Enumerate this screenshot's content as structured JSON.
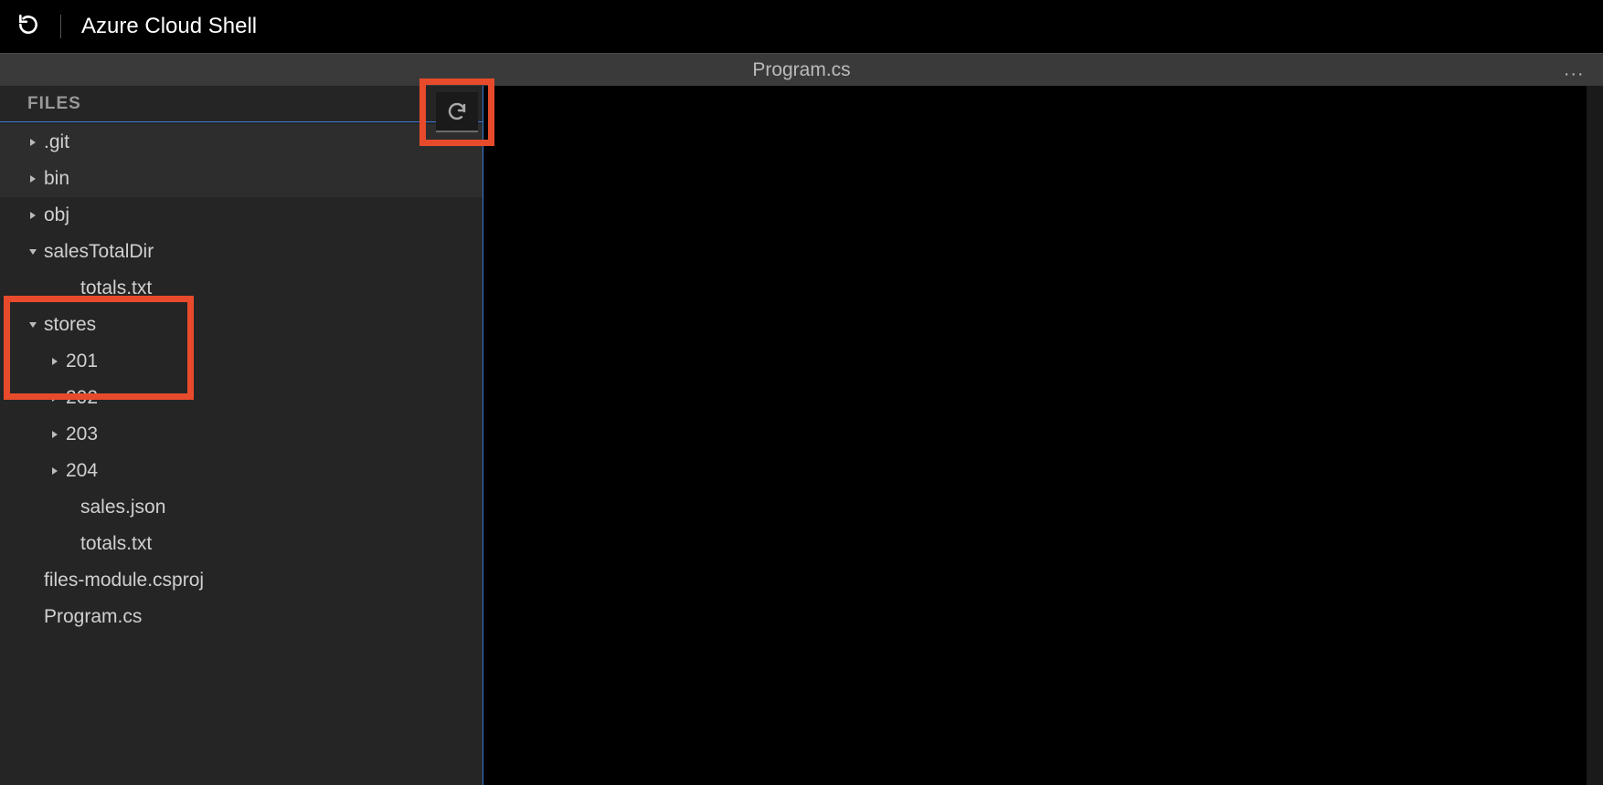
{
  "header": {
    "title": "Azure Cloud Shell"
  },
  "tab": {
    "title": "Program.cs",
    "more": "..."
  },
  "sidebar": {
    "header": "FILES",
    "tree": [
      {
        "label": ".git",
        "indent": 0,
        "chevron": "right",
        "dim": true
      },
      {
        "label": "bin",
        "indent": 0,
        "chevron": "right",
        "dim": true
      },
      {
        "label": "obj",
        "indent": 0,
        "chevron": "right",
        "dim": false
      },
      {
        "label": "salesTotalDir",
        "indent": 0,
        "chevron": "down",
        "dim": false
      },
      {
        "label": "totals.txt",
        "indent": 2,
        "chevron": "",
        "dim": false
      },
      {
        "label": "stores",
        "indent": 0,
        "chevron": "down",
        "dim": false
      },
      {
        "label": "201",
        "indent": 1,
        "chevron": "right",
        "dim": false
      },
      {
        "label": "202",
        "indent": 1,
        "chevron": "right",
        "dim": false
      },
      {
        "label": "203",
        "indent": 1,
        "chevron": "right",
        "dim": false
      },
      {
        "label": "204",
        "indent": 1,
        "chevron": "right",
        "dim": false
      },
      {
        "label": "sales.json",
        "indent": 2,
        "chevron": "",
        "dim": false
      },
      {
        "label": "totals.txt",
        "indent": 2,
        "chevron": "",
        "dim": false
      },
      {
        "label": "files-module.csproj",
        "indent": 0,
        "chevron": "",
        "dim": false
      },
      {
        "label": "Program.cs",
        "indent": 0,
        "chevron": "",
        "dim": false
      }
    ]
  },
  "highlights": {
    "color": "#e84b2b"
  }
}
